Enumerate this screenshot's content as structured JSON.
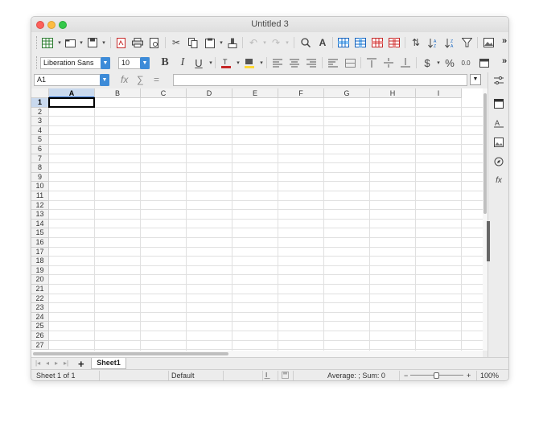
{
  "window": {
    "title": "Untitled 3"
  },
  "toolbar2": {
    "font_name": "Liberation Sans",
    "font_size": "10"
  },
  "formula_bar": {
    "name_box": "A1",
    "fx": "fx",
    "sum": "∑",
    "equals": "=",
    "content": ""
  },
  "columns": [
    "A",
    "B",
    "C",
    "D",
    "E",
    "F",
    "G",
    "H",
    "I"
  ],
  "rows": [
    "1",
    "2",
    "3",
    "4",
    "5",
    "6",
    "7",
    "8",
    "9",
    "10",
    "11",
    "12",
    "13",
    "14",
    "15",
    "16",
    "17",
    "18",
    "19",
    "20",
    "21",
    "22",
    "23",
    "24",
    "25",
    "26",
    "27"
  ],
  "selected_cell": {
    "column": "A",
    "row": "1"
  },
  "sheet_tabs": {
    "add": "+",
    "active": "Sheet1"
  },
  "status": {
    "sheet_info": "Sheet 1 of 1",
    "page_style": "Default",
    "aggregate": "Average: ; Sum: 0",
    "zoom_minus": "−",
    "zoom_plus": "+",
    "zoom": "100%"
  },
  "icons": {
    "toolbar1": [
      "table-icon",
      "dropdown-icon",
      "open-icon",
      "dropdown-icon",
      "save-icon",
      "dropdown-icon",
      "export-pdf-icon",
      "print-icon",
      "print-preview-icon",
      "cut-icon",
      "copy-icon",
      "paste-icon",
      "dropdown-icon",
      "clone-format-icon",
      "undo-icon",
      "redo-icon",
      "find-icon",
      "spellcheck-icon",
      "row-icon",
      "column-icon",
      "insert-row-icon",
      "delete-row-icon",
      "sort-icon",
      "sort-asc-icon",
      "sort-desc-icon",
      "autofilter-icon",
      "image-icon",
      "more-icon"
    ],
    "sidebar": [
      "properties-icon",
      "styles-icon",
      "gallery-icon",
      "navigator-icon",
      "functions-icon"
    ]
  }
}
